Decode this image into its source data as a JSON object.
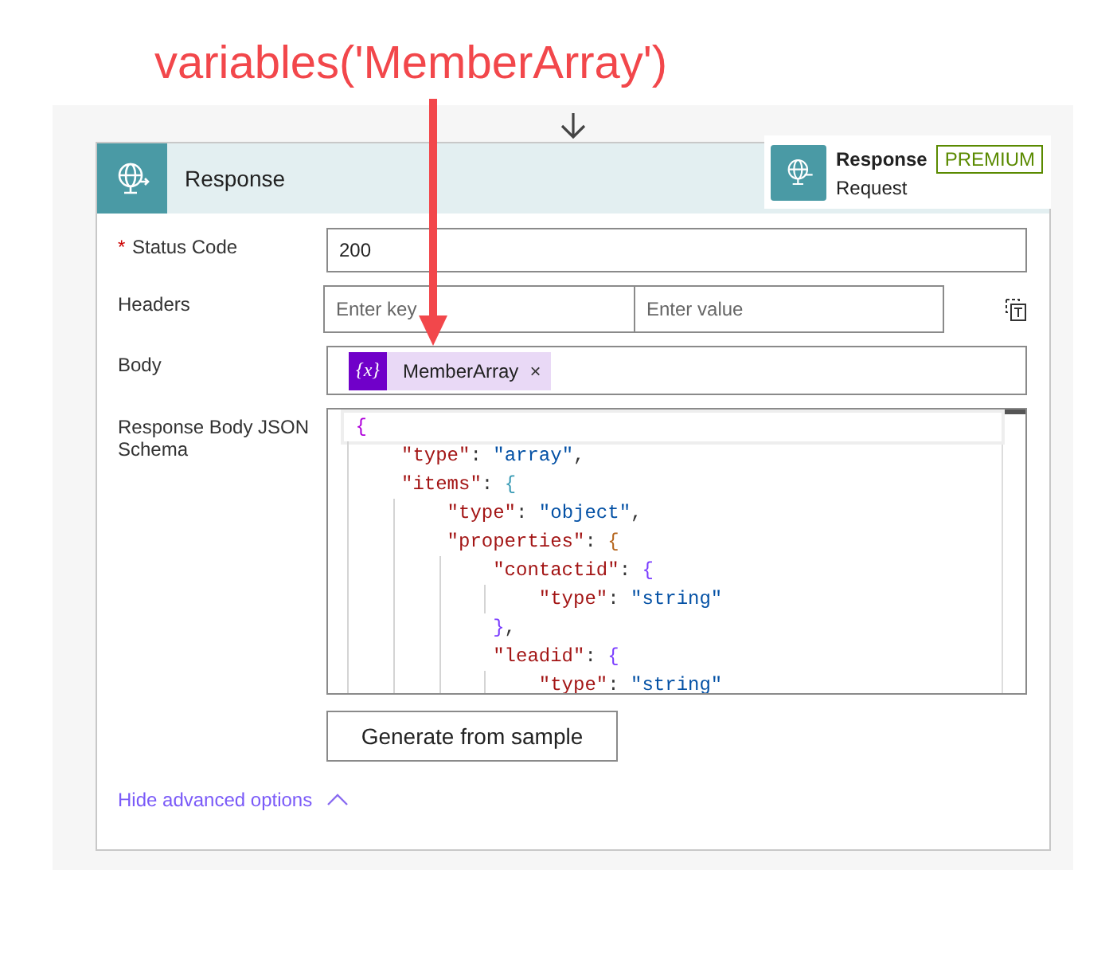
{
  "annotation": {
    "text": "variables('MemberArray')"
  },
  "card": {
    "title": "Response",
    "tooltip": {
      "name": "Response",
      "badge": "PREMIUM",
      "subtitle": "Request"
    },
    "fields": [
      {
        "kind": "text",
        "label": "Status Code",
        "required_mark": "*",
        "value": "200"
      },
      {
        "kind": "pair",
        "label": "Headers",
        "key_placeholder": "Enter key",
        "value_placeholder": "Enter value"
      },
      {
        "kind": "token",
        "label": "Body",
        "token": "MemberArray",
        "token_icon": "{x}",
        "remove": "×"
      },
      {
        "kind": "code",
        "label": "Response Body JSON Schema",
        "button": "Generate from sample",
        "lines": [
          {
            "tokens": [
              {
                "kind": "brace",
                "text": "{",
                "color": "#af00db"
              }
            ],
            "children": [
              {
                "tokens": [
                  {
                    "kind": "key",
                    "text": "\"type\""
                  },
                  {
                    "kind": "punct",
                    "text": ": "
                  },
                  {
                    "kind": "string",
                    "text": "\"array\""
                  },
                  {
                    "kind": "punct",
                    "text": ","
                  }
                ]
              },
              {
                "tokens": [
                  {
                    "kind": "key",
                    "text": "\"items\""
                  },
                  {
                    "kind": "punct",
                    "text": ": "
                  },
                  {
                    "kind": "brace",
                    "text": "{",
                    "color": "#3a9bb5"
                  }
                ],
                "children": [
                  {
                    "tokens": [
                      {
                        "kind": "key",
                        "text": "\"type\""
                      },
                      {
                        "kind": "punct",
                        "text": ": "
                      },
                      {
                        "kind": "string",
                        "text": "\"object\""
                      },
                      {
                        "kind": "punct",
                        "text": ","
                      }
                    ]
                  },
                  {
                    "tokens": [
                      {
                        "kind": "key",
                        "text": "\"properties\""
                      },
                      {
                        "kind": "punct",
                        "text": ": "
                      },
                      {
                        "kind": "brace",
                        "text": "{",
                        "color": "#b5651d"
                      }
                    ],
                    "children": [
                      {
                        "tokens": [
                          {
                            "kind": "key",
                            "text": "\"contactid\""
                          },
                          {
                            "kind": "punct",
                            "text": ": "
                          },
                          {
                            "kind": "brace",
                            "text": "{",
                            "color": "#7a3cff"
                          }
                        ],
                        "children": [
                          {
                            "tokens": [
                              {
                                "kind": "key",
                                "text": "\"type\""
                              },
                              {
                                "kind": "punct",
                                "text": ": "
                              },
                              {
                                "kind": "string",
                                "text": "\"string\""
                              }
                            ]
                          }
                        ]
                      },
                      {
                        "tokens": [
                          {
                            "kind": "brace",
                            "text": "}",
                            "color": "#7a3cff"
                          },
                          {
                            "kind": "punct",
                            "text": ","
                          }
                        ]
                      },
                      {
                        "tokens": [
                          {
                            "kind": "key",
                            "text": "\"leadid\""
                          },
                          {
                            "kind": "punct",
                            "text": ": "
                          },
                          {
                            "kind": "brace",
                            "text": "{",
                            "color": "#7a3cff"
                          }
                        ],
                        "children": [
                          {
                            "tokens": [
                              {
                                "kind": "key",
                                "text": "\"type\""
                              },
                              {
                                "kind": "punct",
                                "text": ": "
                              },
                              {
                                "kind": "string",
                                "text": "\"string\""
                              }
                            ]
                          }
                        ]
                      }
                    ]
                  }
                ]
              }
            ]
          }
        ]
      }
    ],
    "advanced": {
      "label": "Hide advanced options",
      "expanded": true
    }
  }
}
